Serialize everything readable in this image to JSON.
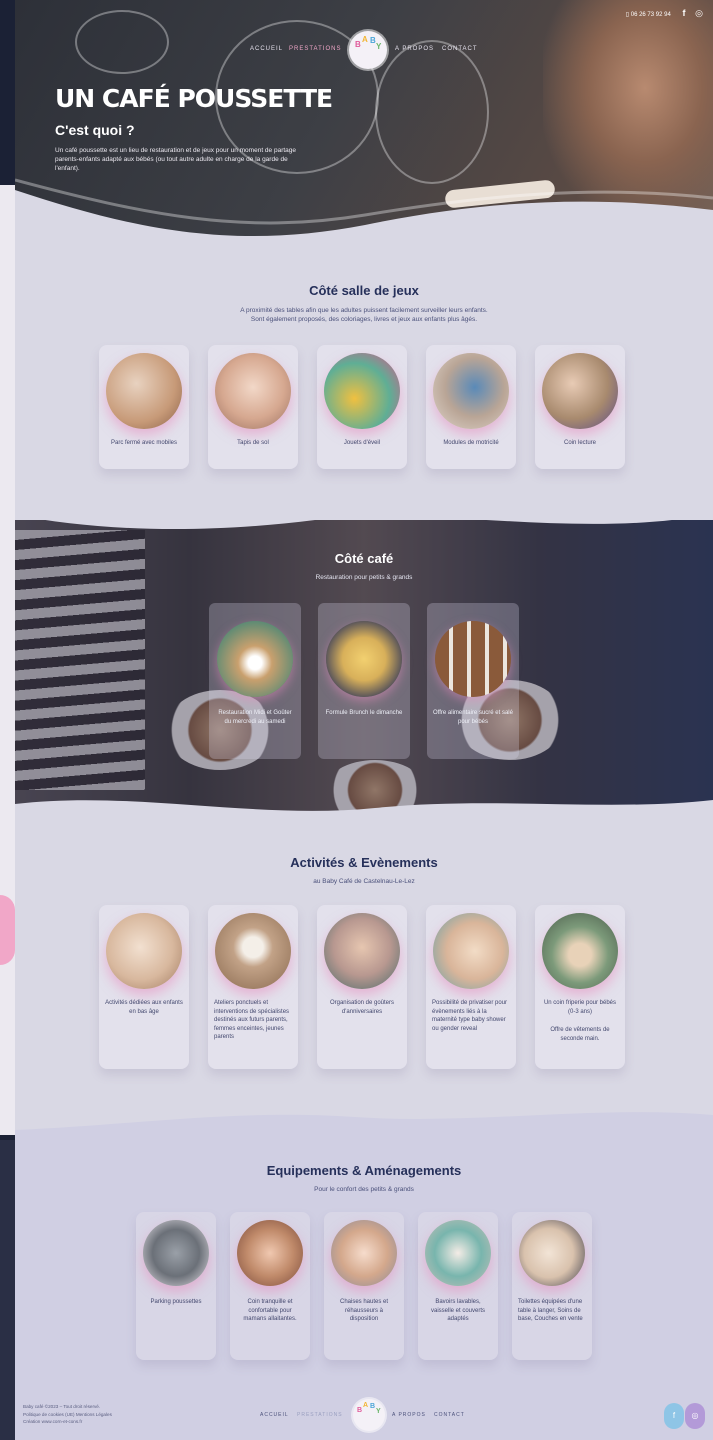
{
  "topbar": {
    "phone": "06 26 73 92 94",
    "facebook_icon": "f",
    "instagram_icon": "◎"
  },
  "nav": {
    "accueil": "ACCUEIL",
    "prestations": "PRESTATIONS",
    "a_propos": "A PROPOS",
    "contact": "CONTACT"
  },
  "logo": {
    "letters": [
      "B",
      "A",
      "B",
      "Y"
    ]
  },
  "hero": {
    "title": "UN CAFÉ POUSSETTE",
    "subtitle": "C'est quoi ?",
    "text": "Un café poussette est un lieu de restauration et de jeux pour un moment de partage parents-enfants adapté aux bébés (ou tout autre adulte en charge de la garde de l'enfant)."
  },
  "jeux": {
    "title": "Côté salle de jeux",
    "subtitle": "A proximité des tables afin que les adultes puissent facilement surveiller leurs enfants. Sont également proposés, des coloriages, livres et jeux aux enfants plus âgés.",
    "items": [
      {
        "label": "Parc fermé avec mobiles",
        "color": "#c79a78"
      },
      {
        "label": "Tapis de sol",
        "color": "#d6a890"
      },
      {
        "label": "Jouets d'éveil",
        "color": "#5fae95"
      },
      {
        "label": "Modules de motricité",
        "color": "#b9a596"
      },
      {
        "label": "Coin lecture",
        "color": "#a88a6e"
      }
    ]
  },
  "cafe": {
    "title": "Côté café",
    "subtitle": "Restauration pour petits & grands",
    "items": [
      {
        "label": "Restauration Midi et Goûter du mercredi au samedi",
        "color": "#c9a06e"
      },
      {
        "label": "Formule Brunch le dimanche",
        "color": "#d8b05a"
      },
      {
        "label": "Offre alimentaire sucré et salé pour bébés",
        "color": "#8a5a3a"
      }
    ]
  },
  "activites": {
    "title": "Activités & Evènements",
    "subtitle": "au Baby Café de Castelnau-Le-Lez",
    "items": [
      {
        "label": "Activités dédiées aux enfants en bas âge",
        "color": "#d8b89e"
      },
      {
        "label": "Ateliers ponctuels et interventions de spécialistes destinés aux futurs parents, femmes enceintes, jeunes parents",
        "color": "#c2a287"
      },
      {
        "label": "Organisation de goûters d'anniversaires",
        "color": "#b89890"
      },
      {
        "label": "Possibilité de privatiser pour évènements liés à la maternité type baby shower ou gender reveal",
        "color": "#d9b59a"
      },
      {
        "label": "Un coin friperie pour bébés (0-3 ans)",
        "extra": "Offre de vêtements de seconde main.",
        "color": "#7c9a7a"
      }
    ]
  },
  "equipements": {
    "title": "Equipements & Aménagements",
    "subtitle": "Pour le confort des petits & grands",
    "items": [
      {
        "label": "Parking poussettes",
        "color": "#6b7078"
      },
      {
        "label": "Coin tranquille et confortable pour mamans allaitantes.",
        "color": "#c08a6a"
      },
      {
        "label": "Chaises hautes et réhausseurs à disposition",
        "color": "#d4a88c"
      },
      {
        "label": "Bavoirs lavables, vaisselle et couverts adaptés",
        "color": "#78b5ad"
      },
      {
        "label": "Toilettes équipées d'une table à langer, Soins de base, Couches en vente",
        "color": "#d9c2ad"
      }
    ]
  },
  "footer": {
    "line1": "Baby café ©2023 – Tout droit réservé.",
    "line2": "Politique de cookies (UE)    Mentions Légales",
    "line3": "Création www.corn-et-cons.fr",
    "nav": {
      "accueil": "ACCUEIL",
      "prestations": "PRESTATIONS",
      "a_propos": "A PROPOS",
      "contact": "CONTACT"
    },
    "facebook": "f",
    "instagram": "◎",
    "fb_color": "#8ec5e6",
    "ig_color": "#b39ad8"
  }
}
